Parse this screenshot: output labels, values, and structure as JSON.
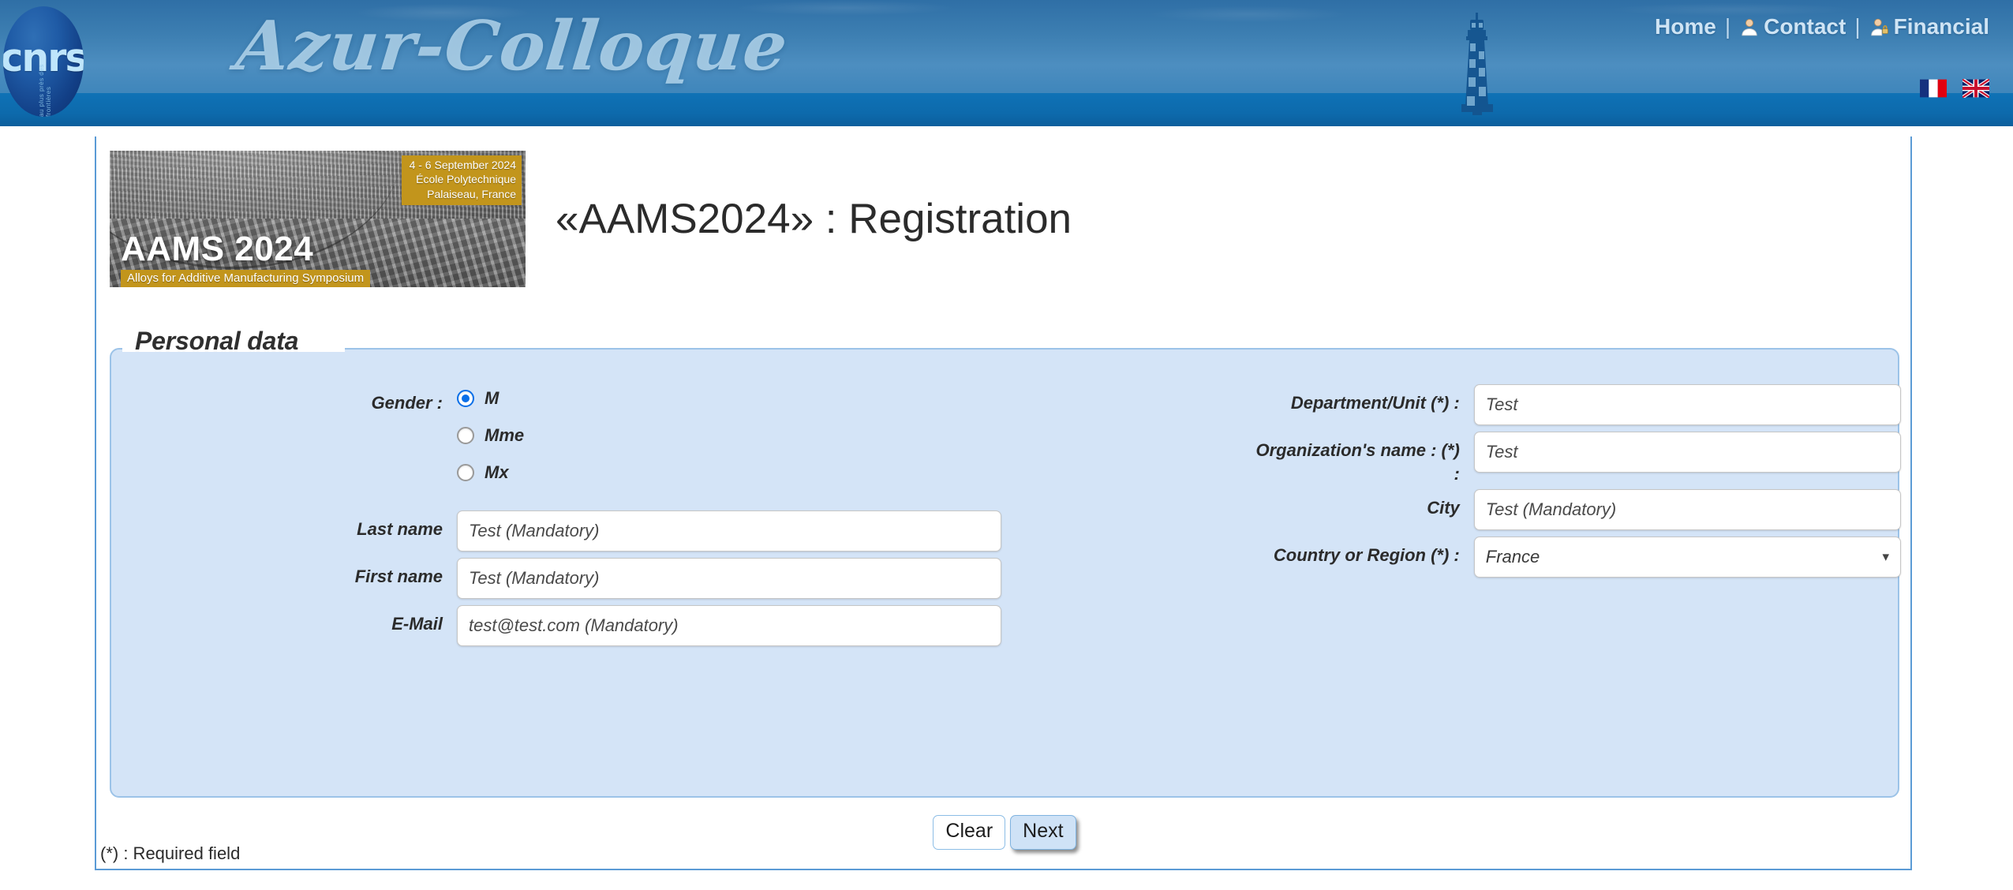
{
  "header": {
    "logo_text": "cnrs",
    "logo_subtitle": "au plus près des frontières",
    "wordmark": "Azur-Colloque",
    "nav": {
      "home": "Home",
      "sep1": "|",
      "contact": "Contact",
      "sep2": "|",
      "financial": "Financial"
    },
    "languages": [
      {
        "name": "french-flag",
        "label": "Français"
      },
      {
        "name": "english-flag",
        "label": "English"
      }
    ],
    "colors": {
      "sky": "#3d7fb2",
      "sea": "#0f72b6",
      "nav_text": "#cfe4f4"
    }
  },
  "banner": {
    "date_line1": "4 - 6 September 2024",
    "date_line2": "École Polytechnique",
    "date_line3": "Palaiseau, France",
    "title": "AAMS 2024",
    "subtitle": "Alloys for Additive Manufacturing Symposium",
    "highlight_color": "#c2951c"
  },
  "page": {
    "title": "«AAMS2024» : Registration",
    "footnote": "(*) : Required field"
  },
  "form": {
    "legend": "Personal data",
    "gender": {
      "label": "Gender :",
      "options": [
        {
          "label": "M",
          "selected": true
        },
        {
          "label": "Mme",
          "selected": false
        },
        {
          "label": "Mx",
          "selected": false
        }
      ]
    },
    "left_fields": [
      {
        "label": "Last name",
        "value": "Test (Mandatory)",
        "name": "last-name"
      },
      {
        "label": "First name",
        "value": "Test (Mandatory)",
        "name": "first-name"
      },
      {
        "label": "E-Mail",
        "value": "test@test.com (Mandatory)",
        "name": "email"
      }
    ],
    "right_fields": [
      {
        "label": "Department/Unit (*) :",
        "value": "Test",
        "name": "department-unit"
      },
      {
        "label": "Organization's name : (*)\n:",
        "value": "Test",
        "name": "organization-name"
      },
      {
        "label": "City",
        "value": "Test (Mandatory)",
        "name": "city"
      }
    ],
    "country": {
      "label": "Country or Region (*) :",
      "value": "France"
    },
    "buttons": {
      "clear": "Clear",
      "next": "Next"
    },
    "colors": {
      "fieldset_bg": "#d4e4f7",
      "fieldset_border": "#9cc3e8",
      "radio_accent": "#0a6fe8",
      "primary_button_bg": "#cfe2f6"
    }
  }
}
